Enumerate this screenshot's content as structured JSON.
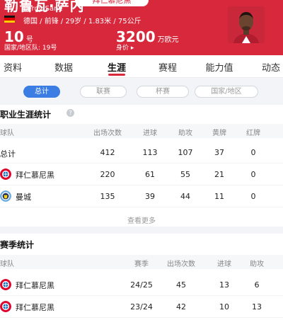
{
  "player": {
    "name_cn": "勒鲁瓦·萨内",
    "team_pill": "拜仁慕尼黑",
    "name_en": "Leroy Sané",
    "info": "德国 / 前锋 / 29岁 / 1.83米 / 75公斤",
    "jersey_number": "10",
    "jersey_unit": "号",
    "national_team": "国家/地区队: 19号",
    "market_value": "3200",
    "market_value_unit": "万欧元",
    "value_label": "身价 ▸"
  },
  "flag_colors": [
    "#111111",
    "#dd0000",
    "#ffce00"
  ],
  "tabs": [
    "资料",
    "数据",
    "生涯",
    "赛程",
    "能力值",
    "动态"
  ],
  "active_tab": "生涯",
  "filters": [
    "总计",
    "联赛",
    "杯赛",
    "国家/地区"
  ],
  "active_filter": "总计",
  "career": {
    "title": "职业生涯统计",
    "help_icon": "?",
    "columns": [
      "球队",
      "出场次数",
      "进球",
      "助攻",
      "黄牌",
      "红牌"
    ],
    "rows": [
      {
        "team": "总计",
        "logo": "",
        "apps": "412",
        "goals": "113",
        "assists": "107",
        "yellow": "37",
        "red": "0"
      },
      {
        "team": "拜仁慕尼黑",
        "logo": "bayern-logo-icon",
        "apps": "220",
        "goals": "61",
        "assists": "55",
        "yellow": "21",
        "red": "0"
      },
      {
        "team": "曼城",
        "logo": "man-city-logo-icon",
        "apps": "135",
        "goals": "39",
        "assists": "44",
        "yellow": "11",
        "red": "0"
      }
    ],
    "see_more": "查看更多"
  },
  "season": {
    "title": "赛季统计",
    "columns": [
      "球队",
      "赛季",
      "出场次数",
      "进球",
      "助攻"
    ],
    "rows": [
      {
        "team": "拜仁慕尼黑",
        "logo": "bayern-logo-icon",
        "season": "24/25",
        "apps": "45",
        "goals": "13",
        "assists": "6"
      },
      {
        "team": "拜仁慕尼黑",
        "logo": "bayern-logo-icon",
        "season": "23/24",
        "apps": "42",
        "goals": "10",
        "assists": "13"
      }
    ]
  },
  "colors": {
    "brand_red": "#d7283c",
    "active_blue": "#3b7de3",
    "bayern_red": "#dc052d",
    "city_blue": "#6cabdd"
  }
}
